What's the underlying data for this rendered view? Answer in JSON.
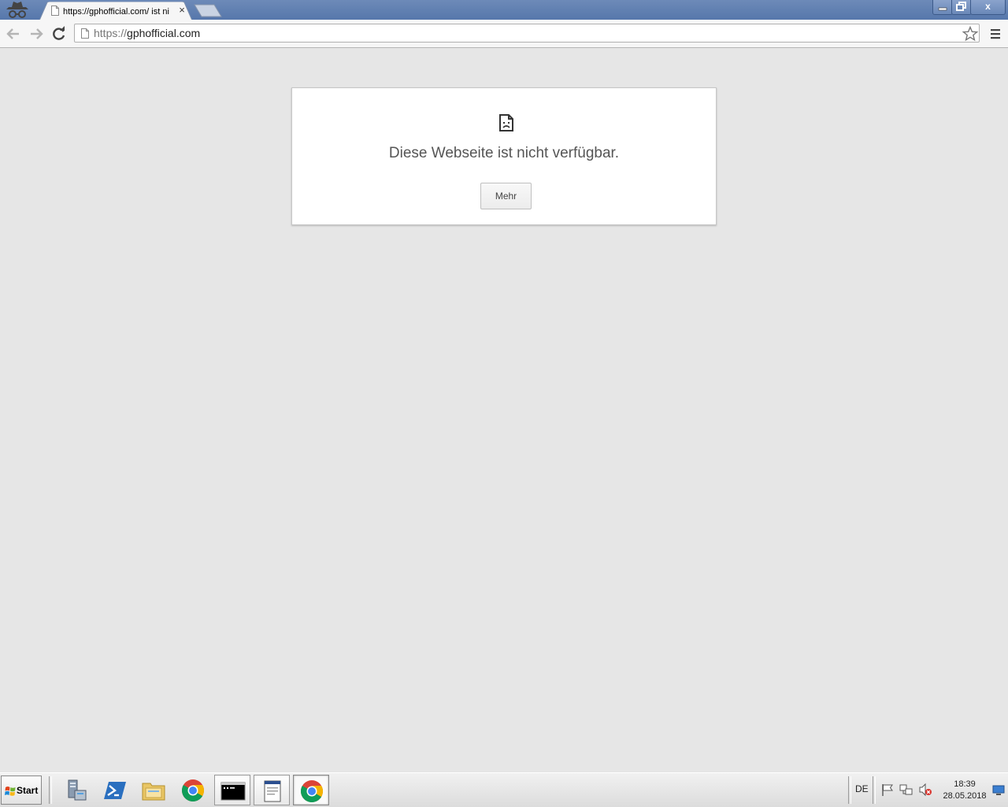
{
  "browser": {
    "tab": {
      "title": "https://gphofficial.com/ ist ni",
      "close_glyph": "×"
    },
    "window_buttons": {
      "close_glyph": "x"
    },
    "address_bar": {
      "scheme": "https://",
      "host": "gphofficial.com"
    }
  },
  "error_page": {
    "title": "Diese Webseite ist nicht verfügbar.",
    "more_button": "Mehr"
  },
  "taskbar": {
    "start_label": "Start",
    "items": [
      {
        "name": "server-manager-icon"
      },
      {
        "name": "powershell-icon"
      },
      {
        "name": "explorer-icon"
      },
      {
        "name": "chrome-icon"
      },
      {
        "name": "cmd-icon"
      },
      {
        "name": "notepad-icon"
      },
      {
        "name": "chrome-icon",
        "active": true
      }
    ],
    "language": "DE",
    "clock": {
      "time": "18:39",
      "date": "28.05.2018"
    }
  },
  "colors": {
    "page_background": "#e6e6e6",
    "title_bar": "#5677ab",
    "card_text": "#555555"
  }
}
